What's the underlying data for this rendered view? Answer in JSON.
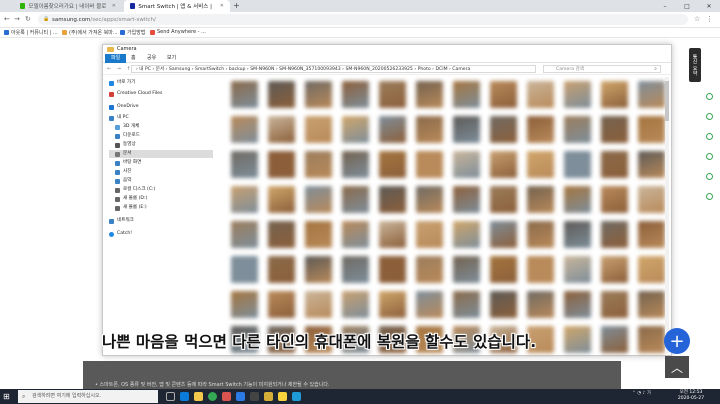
{
  "browser": {
    "tabs": [
      {
        "label": "모델이름찾으러가요 | 네이버 블로그",
        "active": false,
        "color": "#2db400"
      },
      {
        "label": "Smart Switch | 앱 & 서비스 | Samsung 대한민국",
        "active": true,
        "color": "#1428a0"
      }
    ],
    "new_tab": "+",
    "window_controls": {
      "minimize": "–",
      "maximize": "□",
      "close": "✕"
    },
    "url": {
      "host": "samsung.com",
      "path": "/sec/apps/smart-switch/"
    },
    "bookmarks": [
      {
        "label": "아웃룩 | 커뮤니티 | ...",
        "color": "#2b6cd4"
      },
      {
        "label": "(주)에서 가져온 북마...",
        "color": "#e8a33a"
      },
      {
        "label": "가입방법",
        "color": "#2b6cd4"
      },
      {
        "label": "Send Anywhere - ...",
        "color": "#e74c3c"
      }
    ]
  },
  "side_badge": "통신 요약",
  "explorer": {
    "title": "Camera",
    "ribbon_tabs": [
      "파일",
      "홈",
      "공유",
      "보기"
    ],
    "address_path": "› 내 PC › 문서 › Samsung › SmartSwitch › backup › SM-N960N › SM-N960N_357100093943 › SM-N960N_20200526233925 › Photo › DCIM › Camera",
    "search_placeholder": "Camera 검색",
    "nav_items": [
      {
        "label": "바로 가기",
        "color": "#1e88e5"
      },
      {
        "label": "Creative Cloud Files",
        "color": "#d43f3a"
      },
      {
        "label": "OneDrive",
        "color": "#1976d2"
      },
      {
        "label": "내 PC",
        "color": "#3b82c4"
      },
      {
        "label": "3D 개체",
        "color": "#5aa0d8"
      },
      {
        "label": "다운로드",
        "color": "#3b82c4"
      },
      {
        "label": "동영상",
        "color": "#555555"
      },
      {
        "label": "문서",
        "color": "#777777"
      },
      {
        "label": "바탕 화면",
        "color": "#3b82c4"
      },
      {
        "label": "사진",
        "color": "#3b82c4"
      },
      {
        "label": "음악",
        "color": "#3b82c4"
      },
      {
        "label": "로컬 디스크 (C:)",
        "color": "#666666"
      },
      {
        "label": "새 볼륨 (D:)",
        "color": "#666666"
      },
      {
        "label": "새 볼륨 (E:)",
        "color": "#666666"
      },
      {
        "label": "네트워크",
        "color": "#3b82c4"
      },
      {
        "label": "Catch!",
        "color": "#1e88e5"
      }
    ]
  },
  "subtitle": "나쁜 마음을 먹으면 다른 타인의 휴대폰에 복원을 할수도 있습니다.",
  "page_note": "• 스마트폰, OS 종류 및 버전, 앱 및 콘텐츠 등에 따라 Smart Switch 기능이 미지원되거나 제한될 수 있습니다.",
  "fab_label": "+",
  "top_button": "︿",
  "taskbar": {
    "search_placeholder": "검색하려면 여기에 입력하십시오.",
    "clock_time": "오전 12:53",
    "clock_date": "2020-05-27"
  }
}
